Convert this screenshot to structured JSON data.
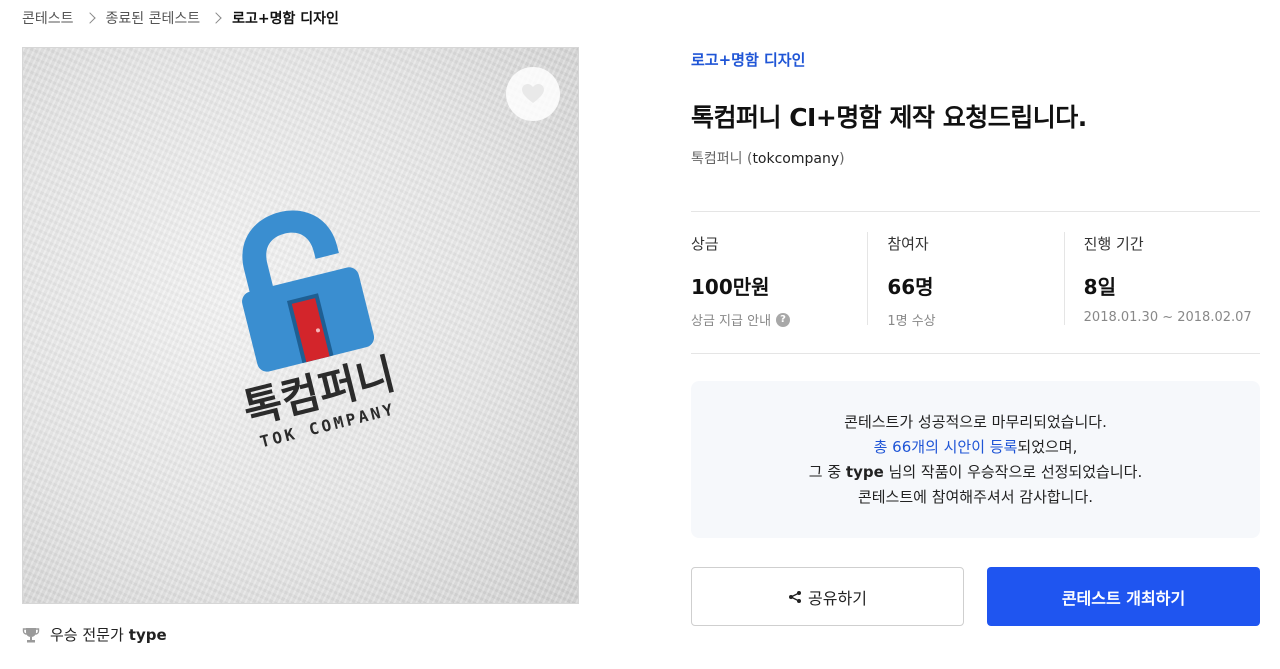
{
  "breadcrumb": {
    "items": [
      "콘테스트",
      "종료된 콘테스트",
      "로고+명함 디자인"
    ]
  },
  "artwork": {
    "brand_ko": "톡컴퍼니",
    "brand_en": "TOK COMPANY",
    "colors": {
      "lock_blue": "#3a8ed0",
      "door_red": "#d3252b",
      "text_dark": "#2b2b2b"
    }
  },
  "winner": {
    "label": "우승 전문가",
    "name": "type"
  },
  "contest": {
    "category": "로고+명함 디자인",
    "title": "톡컴퍼니 CI+명함 제작 요청드립니다.",
    "host_name": "톡컴퍼니 (",
    "host_handle": "tokcompany",
    "host_close": ")"
  },
  "stats": {
    "prize": {
      "label": "상금",
      "value": "100만원",
      "sub": "상금 지급 안내"
    },
    "participants": {
      "label": "참여자",
      "value": "66명",
      "sub": "1명 수상"
    },
    "duration": {
      "label": "진행 기간",
      "value": "8일",
      "sub": "2018.01.30 ~ 2018.02.07"
    }
  },
  "notice": {
    "line1": "콘테스트가 성공적으로 마무리되었습니다.",
    "line2_link": "총 66개의 시안이 등록",
    "line2_rest": "되었으며,",
    "line3_pre": "그 중 ",
    "line3_name": "type",
    "line3_post": " 님의 작품이 우승작으로 선정되었습니다.",
    "line4": "콘테스트에 참여해주셔서 감사합니다."
  },
  "actions": {
    "share_label": "공유하기",
    "host_label": "콘테스트 개최하기"
  },
  "icons": {
    "heart": "heart-icon",
    "share": "share-icon",
    "trophy": "trophy-icon",
    "help": "question-icon",
    "chevron": "chevron-right-icon"
  },
  "theme": {
    "accent": "#1f55f0",
    "link": "#1f55d6"
  }
}
